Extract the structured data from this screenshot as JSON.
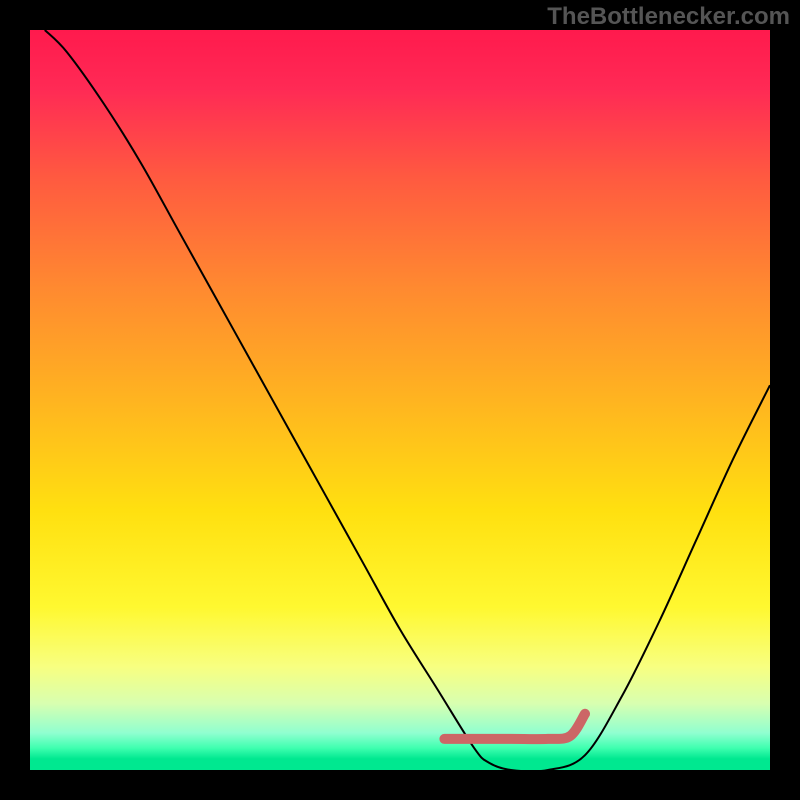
{
  "watermark": "TheBottlenecker.com",
  "chart_data": {
    "type": "line",
    "title": "",
    "xlabel": "",
    "ylabel": "",
    "xlim": [
      0,
      100
    ],
    "ylim": [
      0,
      100
    ],
    "background_gradient": {
      "stops": [
        {
          "pos": 0.0,
          "color": "#ff1a4d"
        },
        {
          "pos": 0.08,
          "color": "#ff2a55"
        },
        {
          "pos": 0.2,
          "color": "#ff5a40"
        },
        {
          "pos": 0.35,
          "color": "#ff8a30"
        },
        {
          "pos": 0.5,
          "color": "#ffb420"
        },
        {
          "pos": 0.65,
          "color": "#ffe010"
        },
        {
          "pos": 0.78,
          "color": "#fff830"
        },
        {
          "pos": 0.86,
          "color": "#f8ff80"
        },
        {
          "pos": 0.91,
          "color": "#d8ffb0"
        },
        {
          "pos": 0.95,
          "color": "#90ffd0"
        },
        {
          "pos": 0.97,
          "color": "#40ffb0"
        },
        {
          "pos": 0.985,
          "color": "#00e890"
        },
        {
          "pos": 1.0,
          "color": "#00e890"
        }
      ]
    },
    "series": [
      {
        "name": "bottleneck-curve",
        "stroke": "#000000",
        "stroke_width": 2,
        "x": [
          2,
          5,
          10,
          15,
          20,
          25,
          30,
          35,
          40,
          45,
          50,
          55,
          60,
          62,
          65,
          70,
          75,
          80,
          85,
          90,
          95,
          100
        ],
        "y": [
          100,
          97,
          90,
          82,
          73,
          64,
          55,
          46,
          37,
          28,
          19,
          11,
          3,
          1,
          0,
          0,
          2,
          10,
          20,
          31,
          42,
          52
        ]
      },
      {
        "name": "highlight-segment",
        "stroke": "#cc6666",
        "stroke_width": 10,
        "linecap": "round",
        "x": [
          56,
          60,
          65,
          70,
          73,
          75
        ],
        "y": [
          4.2,
          4.2,
          4.2,
          4.2,
          4.6,
          7.6
        ]
      }
    ]
  }
}
